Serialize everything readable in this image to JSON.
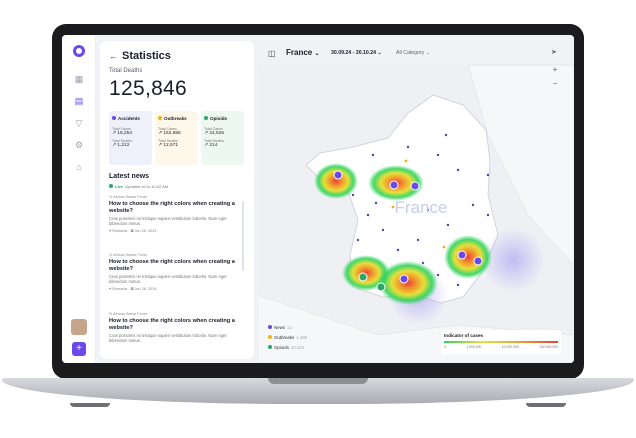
{
  "stats": {
    "title": "Statistics",
    "total_label": "Total Deaths",
    "total_value": "125,846",
    "cards": [
      {
        "title": "Accidents",
        "color": "#6a49e8",
        "bg": "#eef0fb",
        "cases_label": "Total Cases",
        "cases": "15,254",
        "deaths_label": "Total Deaths",
        "deaths": "1,212"
      },
      {
        "title": "Outbreaks",
        "color": "#f2b21b",
        "bg": "#fdf8ea",
        "cases_label": "Total Cases",
        "cases": "152,656",
        "deaths_label": "Total Deaths",
        "deaths": "12,571"
      },
      {
        "title": "Opioids",
        "color": "#2fa567",
        "bg": "#ecf8f1",
        "cases_label": "Total Cases",
        "cases": "24,525",
        "deaths_label": "Total Deaths",
        "deaths": "214"
      }
    ]
  },
  "news": {
    "title": "Latest news",
    "live": "Live",
    "updated": "Updated at 11:10:02 AM",
    "items": [
      {
        "source": "African Swine Fever",
        "headline": "How to choose the right colors when creating a website?",
        "body": "Cras possimis mi tristique sapien vestibulum lobortis. Nam eget bibendum metus.",
        "region": "Romania",
        "date": "Jan 26, 2024"
      },
      {
        "source": "African Swine Fever",
        "headline": "How to choose the right colors when creating a website?",
        "body": "Cras possimis mi tristique sapien vestibulum lobortis. Nam eget bibendum metus.",
        "region": "Romania",
        "date": "Jan 26, 2024"
      },
      {
        "source": "African Swine Fever",
        "headline": "How to choose the right colors when creating a website?",
        "body": "Cras possimis mi tristique sapien vestibulum lobortis. Nam eget bibendum metus.",
        "region": "",
        "date": ""
      }
    ]
  },
  "map": {
    "country": "France",
    "date_range": "30.09.24 - 30.10.24",
    "category": "All Category",
    "map_label": "France",
    "legend": [
      {
        "label": "News",
        "count": "13",
        "color": "#6a49e8"
      },
      {
        "label": "Outbreaks",
        "count": "1,485",
        "color": "#f2b21b"
      },
      {
        "label": "Opioids",
        "count": "10,024",
        "color": "#2fa567"
      }
    ],
    "indicator_title": "Indicator of cases",
    "scale": [
      "0",
      "1,000,000",
      "10,000,000",
      "100,000,000"
    ]
  }
}
